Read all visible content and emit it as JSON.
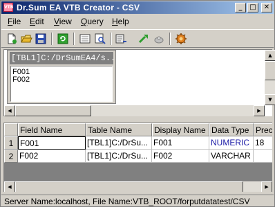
{
  "window": {
    "title": "Dr.Sum EA VTB Creator - CSV",
    "app_icon_text": "VTB",
    "controls": {
      "minimize": "_",
      "maximize": "□",
      "close": "✕"
    }
  },
  "menu": [
    {
      "label": "File",
      "u": "F",
      "rest": "ile"
    },
    {
      "label": "Edit",
      "u": "E",
      "rest": "dit"
    },
    {
      "label": "View",
      "u": "V",
      "rest": "iew"
    },
    {
      "label": "Query",
      "u": "Q",
      "rest": "uery"
    },
    {
      "label": "Help",
      "u": "H",
      "rest": "elp"
    }
  ],
  "toolbar": {
    "icons": [
      "new-icon",
      "open-icon",
      "save-icon",
      "refresh-icon",
      "preview-icon",
      "find-icon",
      "export-icon",
      "run-icon",
      "stop-icon",
      "settings-icon"
    ]
  },
  "table_box": {
    "title": "[TBL1]C:/DrSumEA4/s...",
    "fields": [
      "F001",
      "F002"
    ]
  },
  "grid": {
    "columns": [
      "Field Name",
      "Table Name",
      "Display Name",
      "Data Type",
      "Prec"
    ],
    "rows": [
      {
        "num": "1",
        "field": "F001",
        "table": "[TBL1]C:/DrSu...",
        "display": "F001",
        "type": "NUMERIC",
        "prec": "18"
      },
      {
        "num": "2",
        "field": "F002",
        "table": "[TBL1]C:/DrSu...",
        "display": "F002",
        "type": "VARCHAR",
        "prec": ""
      }
    ],
    "numeric_color": "#1a1aa6"
  },
  "status": {
    "text": "Server Name:localhost, File Name:VTB_ROOT/forputdatatest/CSV"
  }
}
